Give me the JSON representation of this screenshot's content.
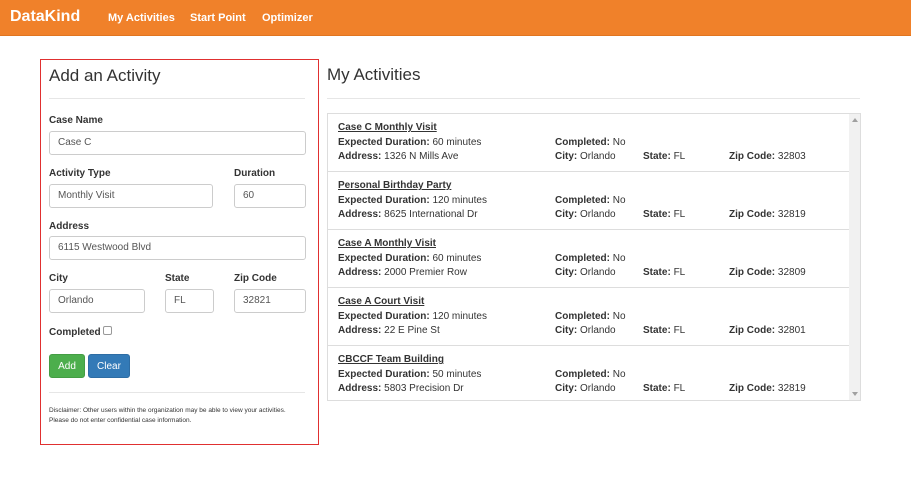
{
  "navbar": {
    "brand": "DataKind",
    "links": [
      "My Activities",
      "Start Point",
      "Optimizer"
    ]
  },
  "form": {
    "title": "Add an Activity",
    "case_name_label": "Case Name",
    "case_name_value": "Case C",
    "activity_type_label": "Activity Type",
    "activity_type_value": "Monthly Visit",
    "duration_label": "Duration",
    "duration_value": "60",
    "address_label": "Address",
    "address_value": "6115 Westwood Blvd",
    "city_label": "City",
    "city_value": "Orlando",
    "state_label": "State",
    "state_value": "FL",
    "zip_label": "Zip Code",
    "zip_value": "32821",
    "completed_label": "Completed",
    "completed_checked": false,
    "add_label": "Add",
    "clear_label": "Clear",
    "disclaimer": "Disclaimer: Other users within the organization may be able to view your activities. Please do not enter confidential case information."
  },
  "list": {
    "title": "My Activities",
    "field_labels": {
      "duration": "Expected Duration:",
      "completed": "Completed:",
      "address": "Address:",
      "city": "City:",
      "state": "State:",
      "zip": "Zip Code:"
    },
    "items": [
      {
        "name": "Case C Monthly Visit",
        "duration": "60 minutes",
        "completed": "No",
        "address": "1326 N Mills Ave",
        "city": "Orlando",
        "state": "FL",
        "zip": "32803"
      },
      {
        "name": "Personal Birthday Party",
        "duration": "120 minutes",
        "completed": "No",
        "address": "8625 International Dr",
        "city": "Orlando",
        "state": "FL",
        "zip": "32819"
      },
      {
        "name": "Case A Monthly Visit",
        "duration": "60 minutes",
        "completed": "No",
        "address": "2000 Premier Row",
        "city": "Orlando",
        "state": "FL",
        "zip": "32809"
      },
      {
        "name": "Case A Court Visit",
        "duration": "120 minutes",
        "completed": "No",
        "address": "22 E Pine St",
        "city": "Orlando",
        "state": "FL",
        "zip": "32801"
      },
      {
        "name": "CBCCF Team Building",
        "duration": "50 minutes",
        "completed": "No",
        "address": "5803 Precision Dr",
        "city": "Orlando",
        "state": "FL",
        "zip": "32819"
      }
    ]
  }
}
